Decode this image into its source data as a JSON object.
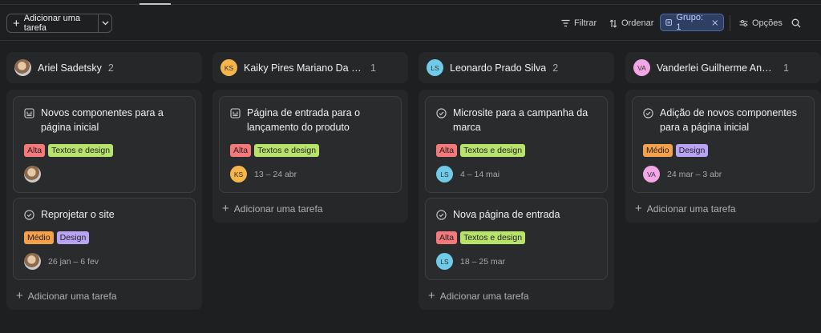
{
  "toolbar": {
    "add_task_label": "Adicionar uma tarefa",
    "filter_label": "Filtrar",
    "sort_label": "Ordenar",
    "group_label": "Grupo: 1",
    "options_label": "Opções"
  },
  "columns": [
    {
      "name": "Ariel Sadetsky",
      "count": "2",
      "avatar": "photo",
      "add_label": "Adicionar uma tarefa",
      "cards": [
        {
          "icon": "milestone-icon",
          "title": "Novos componentes para a página inicial",
          "tags": [
            "Alta",
            "Textos e design"
          ],
          "avatar": "photo",
          "date": ""
        },
        {
          "icon": "check-circle-icon",
          "title": "Reprojetar o site",
          "tags": [
            "Médio",
            "Design"
          ],
          "avatar": "photo",
          "date": "26 jan – 6 fev"
        }
      ]
    },
    {
      "name": "Kaiky Pires Mariano Da SIlva",
      "count": "1",
      "avatar": "KS",
      "add_label": "Adicionar uma tarefa",
      "cards": [
        {
          "icon": "milestone-icon",
          "title": "Página de entrada para o lançamento do produto",
          "tags": [
            "Alta",
            "Textos e design"
          ],
          "avatar": "KS",
          "date": "13 – 24 abr"
        }
      ]
    },
    {
      "name": "Leonardo Prado Silva",
      "count": "2",
      "avatar": "LS",
      "add_label": "Adicionar uma tarefa",
      "cards": [
        {
          "icon": "check-circle-icon",
          "title": "Microsite para a campanha da marca",
          "tags": [
            "Alta",
            "Textos e design"
          ],
          "avatar": "LS",
          "date": "4 – 14 mai"
        },
        {
          "icon": "check-circle-icon",
          "title": "Nova página de entrada",
          "tags": [
            "Alta",
            "Textos e design"
          ],
          "avatar": "LS",
          "date": "18 – 25 mar"
        }
      ]
    },
    {
      "name": "Vanderlei Guilherme Andrad...",
      "count": "1",
      "avatar": "VA",
      "add_label": "Adicionar uma tarefa",
      "cards": [
        {
          "icon": "check-circle-icon",
          "title": "Adição de novos componentes para a página inicial",
          "tags": [
            "Médio",
            "Design"
          ],
          "avatar": "VA",
          "date": "24 mar – 3 abr"
        }
      ]
    }
  ],
  "colors": {
    "background": "#1e1f21",
    "tag_alta": "#f5787a",
    "tag_textos_design": "#b8e36b",
    "tag_medio": "#f5a04b",
    "tag_design": "#b9a3f5",
    "group_chip": "#2f3f63"
  }
}
